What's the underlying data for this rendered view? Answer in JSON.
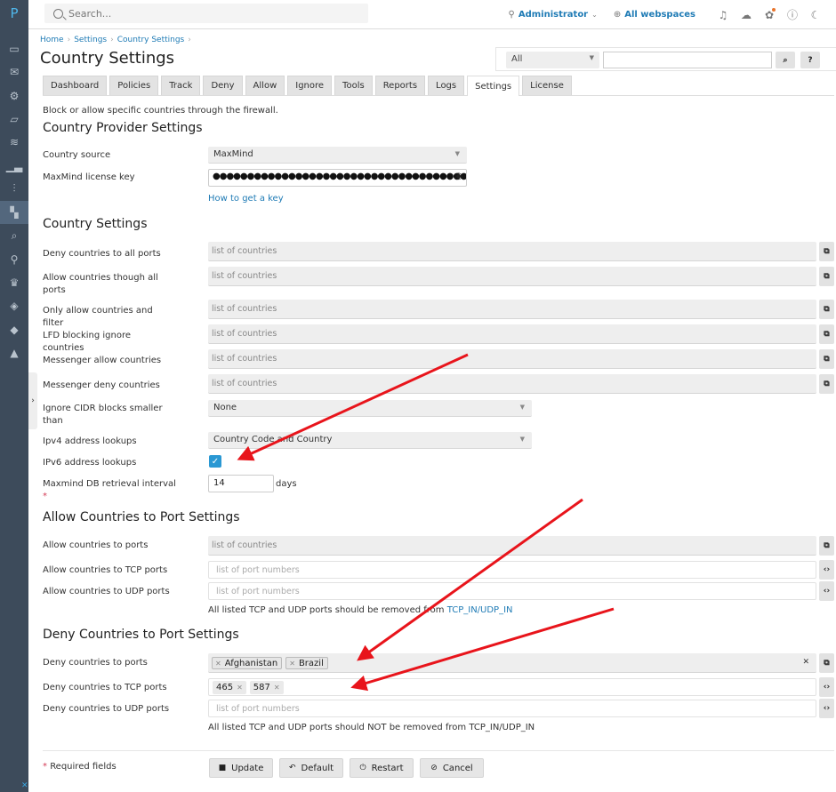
{
  "app": {
    "logo": "P"
  },
  "sidebar": {
    "items": [
      {
        "icon": "monitor-icon",
        "glyph": "▭"
      },
      {
        "icon": "mail-icon",
        "glyph": "✉"
      },
      {
        "icon": "gear-icon",
        "glyph": "⚙"
      },
      {
        "icon": "folder-icon",
        "glyph": "▱"
      },
      {
        "icon": "layers-icon",
        "glyph": "≋"
      },
      {
        "icon": "bar-chart-icon",
        "glyph": "▁▃"
      },
      {
        "icon": "sliders-icon",
        "glyph": "⫶"
      },
      {
        "icon": "dashboard-icon",
        "glyph": "▚"
      },
      {
        "icon": "search-zoom-icon",
        "glyph": "⌕"
      },
      {
        "icon": "user-icon",
        "glyph": "⚲"
      },
      {
        "icon": "crown-icon",
        "glyph": "♛"
      },
      {
        "icon": "shield-yellow-icon",
        "glyph": "◈"
      },
      {
        "icon": "shield-blue-icon",
        "glyph": "◆"
      },
      {
        "icon": "bee-icon",
        "glyph": "▲"
      }
    ],
    "active_index": 7
  },
  "topbar": {
    "search_placeholder": "Search...",
    "user": "Administrator",
    "webspaces": "All webspaces",
    "icons": [
      "notifications-icon",
      "cloud-icon",
      "extensions-icon",
      "help-icon",
      "dark-mode-icon"
    ]
  },
  "breadcrumb": [
    "Home",
    "Settings",
    "Country Settings"
  ],
  "page_title": "Country Settings",
  "filter": {
    "scope": "All",
    "search_value": "",
    "search_button": "⌕",
    "help_button": "?"
  },
  "tabs": [
    "Dashboard",
    "Policies",
    "Track",
    "Deny",
    "Allow",
    "Ignore",
    "Tools",
    "Reports",
    "Logs",
    "Settings",
    "License"
  ],
  "active_tab": "Settings",
  "description": "Block or allow specific countries through the firewall.",
  "provider": {
    "heading": "Country Provider Settings",
    "source_label": "Country source",
    "source_value": "MaxMind",
    "key_label": "MaxMind license key",
    "key_value": "●●●●●●●●●●●●●●●●●●●●●●●●●●●●●●●●●●●●●●●",
    "key_link": "How to get a key"
  },
  "country_settings": {
    "heading": "Country Settings",
    "placeholder": "list of countries",
    "rows": [
      {
        "label": "Deny countries to all ports"
      },
      {
        "label": "Allow countries though all ports"
      },
      {
        "label": "Only allow countries and filter"
      },
      {
        "label": "LFD blocking ignore countries"
      },
      {
        "label": "Messenger allow countries"
      },
      {
        "label": "Messenger deny countries"
      }
    ],
    "cidr_label": "Ignore CIDR blocks smaller than",
    "cidr_value": "None",
    "ipv4_label": "Ipv4 address lookups",
    "ipv4_value": "Country Code and Country",
    "ipv6_label": "IPv6 address lookups",
    "ipv6_checked": true,
    "interval_label": "Maxmind DB retrieval interval",
    "interval_required": "*",
    "interval_value": "14",
    "interval_unit": "days"
  },
  "allow_ports": {
    "heading": "Allow Countries to Port Settings",
    "countries_label": "Allow countries to ports",
    "countries_placeholder": "list of countries",
    "tcp_label": "Allow countries to TCP ports",
    "tcp_placeholder": "list of port numbers",
    "udp_label": "Allow countries to UDP ports",
    "udp_placeholder": "list of port numbers",
    "note_prefix": "All listed TCP and UDP ports should be removed from ",
    "note_link": "TCP_IN/UDP_IN"
  },
  "deny_ports": {
    "heading": "Deny Countries to Port Settings",
    "countries_label": "Deny countries to ports",
    "countries": [
      "Afghanistan",
      "Brazil"
    ],
    "tcp_label": "Deny countries to TCP ports",
    "tcp_ports": [
      "465",
      "587"
    ],
    "udp_label": "Deny countries to UDP ports",
    "udp_placeholder": "list of port numbers",
    "note": "All listed TCP and UDP ports should NOT be removed from TCP_IN/UDP_IN"
  },
  "footer": {
    "required_mark": "*",
    "required_text": "Required fields",
    "buttons": [
      {
        "label": "Update",
        "icon": "save-icon",
        "glyph": "■"
      },
      {
        "label": "Default",
        "icon": "undo-icon",
        "glyph": "↶"
      },
      {
        "label": "Restart",
        "icon": "power-icon",
        "glyph": "⏻"
      },
      {
        "label": "Cancel",
        "icon": "cancel-icon",
        "glyph": "⊘"
      }
    ]
  },
  "annotations": {
    "arrow_color": "#e8141b"
  }
}
